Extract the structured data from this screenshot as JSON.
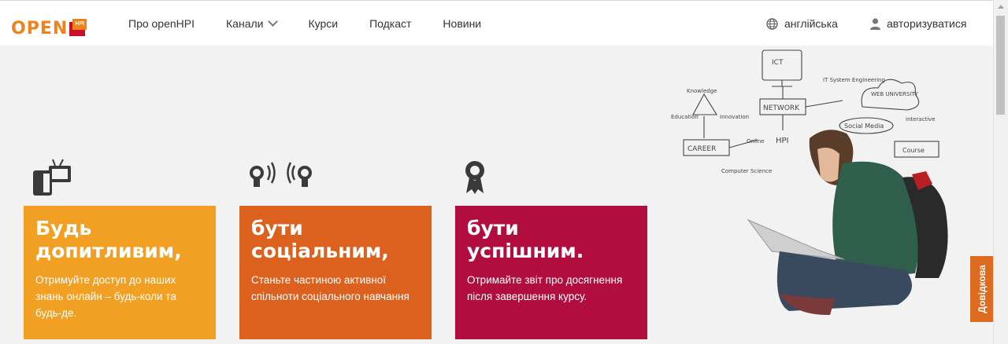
{
  "header": {
    "logo_text": "OPEN",
    "logo_badge": "HPI",
    "nav": [
      "Про openHPI",
      "Канали",
      "Курси",
      "Подкаст",
      "Новини"
    ],
    "language_label": "англійська",
    "login_label": "авторизуватися"
  },
  "features": [
    {
      "title": "Будь допитливим,",
      "text": "Отримуйте доступ до наших знань онлайн – будь-коли та будь-де.",
      "color": "#f2a024",
      "icon": "devices-icon"
    },
    {
      "title": "бути соціальним,",
      "text": "Станьте частиною активної спільноти соціального навчання",
      "color": "#dc601e",
      "icon": "social-bulbs-icon"
    },
    {
      "title": "бути успішним.",
      "text": "Отримайте звіт про досягнення після завершення курсу.",
      "color": "#b10e3f",
      "icon": "award-icon"
    }
  ],
  "feedback_label": "Довідкова",
  "hero_labels": [
    "ICT",
    "Knowledge",
    "Education",
    "Innovation",
    "NETWORK",
    "IT System Engineering",
    "WEB UNIVERSITY",
    "Social Media",
    "interactive",
    "CAREER",
    "Online",
    "HPI",
    "Computer Science",
    "Course"
  ]
}
